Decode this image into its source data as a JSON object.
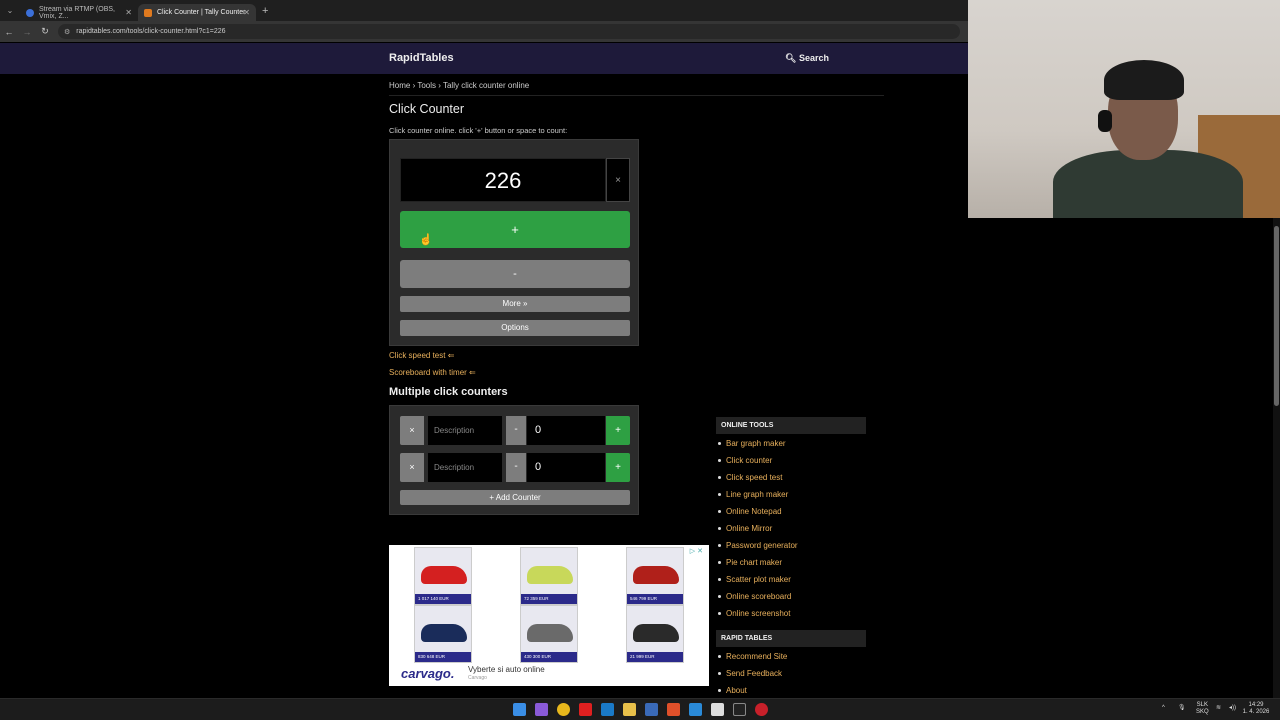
{
  "browser": {
    "tabs": [
      {
        "title": "Stream via RTMP (OBS, Vmix, Z..."
      },
      {
        "title": "Click Counter | Tally Counter"
      }
    ],
    "url": "rapidtables.com/tools/click-counter.html?c1=226"
  },
  "site": {
    "brand": "RapidTables",
    "search_label": "Search"
  },
  "breadcrumb": {
    "home": "Home",
    "tools": "Tools",
    "current": "Tally click counter online"
  },
  "page": {
    "title": "Click Counter",
    "description": "Click counter online. click '+' button or space to count:"
  },
  "counter": {
    "value": "226",
    "clear": "×",
    "plus": "+",
    "minus": "-",
    "more": "More »",
    "options": "Options"
  },
  "links": {
    "speed_test": "Click speed test ⇐",
    "scoreboard": "Scoreboard with timer ⇐"
  },
  "multi": {
    "heading": "Multiple click counters",
    "rows": [
      {
        "remove": "×",
        "placeholder": "Description",
        "minus": "-",
        "value": "0",
        "plus": "+"
      },
      {
        "remove": "×",
        "placeholder": "Description",
        "minus": "-",
        "value": "0",
        "plus": "+"
      }
    ],
    "add": "+ Add Counter"
  },
  "sidebar": {
    "online_tools_heading": "ONLINE TOOLS",
    "online_tools": [
      "Bar graph maker",
      "Click counter",
      "Click speed test",
      "Line graph maker",
      "Online Notepad",
      "Online Mirror",
      "Password generator",
      "Pie chart maker",
      "Scatter plot maker",
      "Online scoreboard",
      "Online screenshot"
    ],
    "rapid_heading": "RAPID TABLES",
    "rapid": [
      "Recommend Site",
      "Send Feedback",
      "About"
    ]
  },
  "ad": {
    "logo": "carvago.",
    "text": "Vyberte si auto online",
    "sub": "Carvago",
    "prices": [
      "1 017 140 EUR",
      "72 359 EUR",
      "546 799 EUR",
      "830 648 EUR",
      "430 300 EUR",
      "21 999 EUR"
    ],
    "car_colors": [
      "#d42020",
      "#c8d85a",
      "#b0201a",
      "#1a2c5a",
      "#6a6a6a",
      "#2a2a2a"
    ]
  },
  "taskbar": {
    "lang": "SLK",
    "lang2": "SKQ",
    "time": "14:29",
    "date": "1. 4. 2026"
  }
}
